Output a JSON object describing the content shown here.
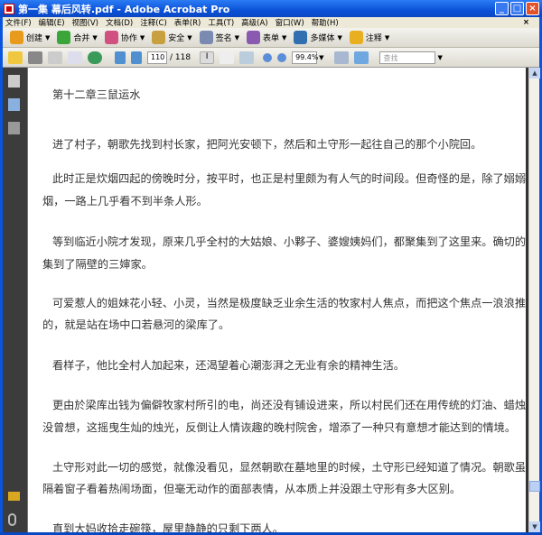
{
  "window": {
    "title": "第一集 幕后风转.pdf - Adobe Acrobat Pro",
    "min": "_",
    "max": "□",
    "close": "×"
  },
  "menu": [
    "文件(F)",
    "编辑(E)",
    "视图(V)",
    "文档(D)",
    "注释(C)",
    "表单(R)",
    "工具(T)",
    "高级(A)",
    "窗口(W)",
    "帮助(H)"
  ],
  "menu_close": "×",
  "toolbar": [
    {
      "label": "创建",
      "icon": "create-icon",
      "color": "#e89a1c"
    },
    {
      "label": "合并",
      "icon": "combine-icon",
      "color": "#3aa63a"
    },
    {
      "label": "协作",
      "icon": "collaborate-icon",
      "color": "#d05080"
    },
    {
      "label": "安全",
      "icon": "lock-icon",
      "color": "#c8a040"
    },
    {
      "label": "签名",
      "icon": "pen-icon",
      "color": "#7a8ab0"
    },
    {
      "label": "表单",
      "icon": "form-icon",
      "color": "#8a5ab0"
    },
    {
      "label": "多媒体",
      "icon": "multimedia-icon",
      "color": "#3070b0"
    },
    {
      "label": "注释",
      "icon": "comment-icon",
      "color": "#e8b020"
    }
  ],
  "nav": {
    "page": "110",
    "total": "/ 118",
    "zoom": "99.4%",
    "search_placeholder": "查找"
  },
  "document": {
    "title": "第十二章三鼠运水",
    "paragraphs": [
      [
        "进了村子，朝歌先找到村长家，把阿光安顿下，然后和土守形一起往自己的那个小院回。"
      ],
      [
        "此时正是炊烟四起的傍晚时分，按平时，也正是村里颇为有人气的时间段。但奇怪的是，除了嫋嫋的炊火四",
        "烟，一路上几乎看不到半条人形。"
      ],
      [
        "等到临近小院才发现，原来几乎全村的大姑娘、小夥子、婆嫂姨妈们，都聚集到了这里来。确切的说，是聚",
        "集到了隔壁的三婶家。"
      ],
      [
        "可爱惹人的姐妹花小轻、小灵，当然是极度缺乏业余生活的牧家村人焦点，而把这个焦点一浪浪推向高潮",
        "的，就是站在场中口若悬河的梁库了。"
      ],
      [
        "看样子，他比全村人加起来，还渴望着心潮澎湃之无业有余的精神生活。"
      ],
      [
        "更由於梁库出钱为偏僻牧家村所引的电，尚还没有铺设进来，所以村民们还在用传统的灯油、蜡烛照明，可",
        "没曾想，这摇曳生灿的烛光，反倒让人情诙趣的晚村院舍，增添了一种只有意想才能达到的情境。"
      ],
      [
        "土守形对此一切的感觉，就像没看见，显然朝歌在墓地里的时候，土守形已经知道了情况。朝歌虽然一直在",
        "隔着窗子看着热闹场面，但毫无动作的面部表情，从本质上并没跟土守形有多大区别。"
      ],
      [
        "直到大妈收拾走碗筷，屋里静静的只剩下两人。"
      ]
    ]
  }
}
